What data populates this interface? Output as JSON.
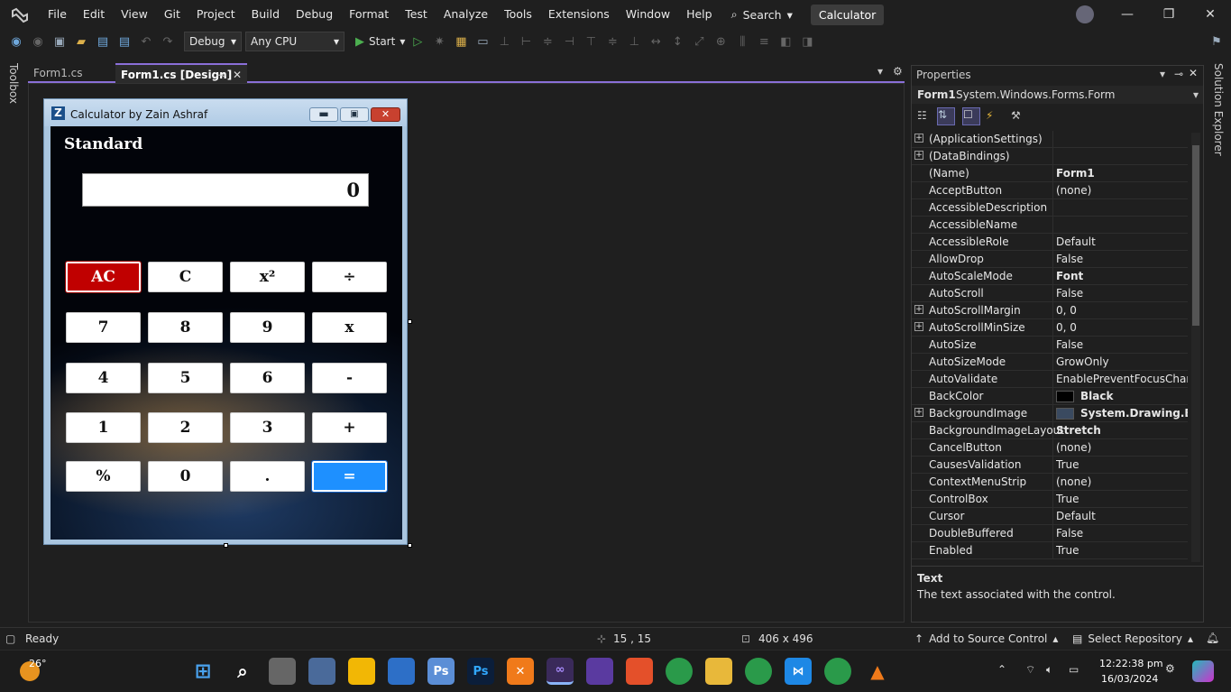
{
  "menu": [
    "File",
    "Edit",
    "View",
    "Git",
    "Project",
    "Build",
    "Debug",
    "Format",
    "Test",
    "Analyze",
    "Tools",
    "Extensions",
    "Window",
    "Help"
  ],
  "search_label": "Search",
  "solution_name": "Calculator",
  "toolbar": {
    "config": "Debug",
    "platform": "Any CPU",
    "start": "Start"
  },
  "sidebar_left": "Toolbox",
  "sidebar_right": "Solution Explorer",
  "tabs": [
    {
      "label": "Form1.cs",
      "active": false
    },
    {
      "label": "Form1.cs [Design]",
      "active": true
    }
  ],
  "calc": {
    "title": "Calculator by Zain Ashraf",
    "mode": "Standard",
    "display": "0",
    "buttons": [
      [
        "AC",
        "C",
        "x²",
        "÷"
      ],
      [
        "7",
        "8",
        "9",
        "x"
      ],
      [
        "4",
        "5",
        "6",
        "-"
      ],
      [
        "1",
        "2",
        "3",
        "+"
      ],
      [
        "%",
        "0",
        ".",
        "="
      ]
    ]
  },
  "properties": {
    "title": "Properties",
    "object": "Form1",
    "object_type": "System.Windows.Forms.Form",
    "rows": [
      {
        "name": "(ApplicationSettings)",
        "value": "",
        "expand": true
      },
      {
        "name": "(DataBindings)",
        "value": "",
        "expand": true
      },
      {
        "name": "(Name)",
        "value": "Form1",
        "bold": true
      },
      {
        "name": "AcceptButton",
        "value": "(none)"
      },
      {
        "name": "AccessibleDescription",
        "value": ""
      },
      {
        "name": "AccessibleName",
        "value": ""
      },
      {
        "name": "AccessibleRole",
        "value": "Default"
      },
      {
        "name": "AllowDrop",
        "value": "False"
      },
      {
        "name": "AutoScaleMode",
        "value": "Font",
        "bold": true
      },
      {
        "name": "AutoScroll",
        "value": "False"
      },
      {
        "name": "AutoScrollMargin",
        "value": "0, 0",
        "expand": true
      },
      {
        "name": "AutoScrollMinSize",
        "value": "0, 0",
        "expand": true
      },
      {
        "name": "AutoSize",
        "value": "False"
      },
      {
        "name": "AutoSizeMode",
        "value": "GrowOnly"
      },
      {
        "name": "AutoValidate",
        "value": "EnablePreventFocusChange"
      },
      {
        "name": "BackColor",
        "value": "Black",
        "bold": true,
        "swatch": "#000000"
      },
      {
        "name": "BackgroundImage",
        "value": "System.Drawing.Bitm",
        "bold": true,
        "expand": true,
        "swatch": "#3a4a60"
      },
      {
        "name": "BackgroundImageLayout",
        "value": "Stretch",
        "bold": true
      },
      {
        "name": "CancelButton",
        "value": "(none)"
      },
      {
        "name": "CausesValidation",
        "value": "True"
      },
      {
        "name": "ContextMenuStrip",
        "value": "(none)"
      },
      {
        "name": "ControlBox",
        "value": "True"
      },
      {
        "name": "Cursor",
        "value": "Default"
      },
      {
        "name": "DoubleBuffered",
        "value": "False"
      },
      {
        "name": "Enabled",
        "value": "True"
      }
    ],
    "desc_title": "Text",
    "desc_text": "The text associated with the control."
  },
  "status": {
    "state": "Ready",
    "position": "15 , 15",
    "size": "406 x 496",
    "source_control": "Add to Source Control",
    "repo": "Select Repository"
  },
  "taskbar": {
    "temp": "26°",
    "time": "12:22:38 pm",
    "date": "16/03/2024"
  },
  "colors": {
    "accent": "#8a6fd8",
    "ac_button": "#c00000",
    "equals_button": "#1e90ff"
  }
}
